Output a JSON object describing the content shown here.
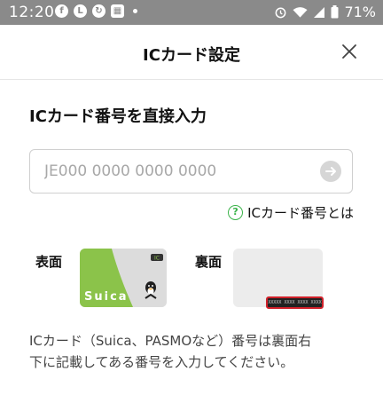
{
  "status_bar": {
    "time": "12:20",
    "battery": "71%",
    "left_icons": [
      "facebook-icon",
      "line-icon",
      "sync-icon",
      "qr-icon"
    ],
    "right_icons": [
      "alarm-icon",
      "wifi-icon",
      "signal-icon",
      "battery-icon"
    ]
  },
  "header": {
    "title": "ICカード設定",
    "close_icon": "close-icon"
  },
  "form": {
    "section_title": "ICカード番号を直接入力",
    "input_value": "",
    "input_placeholder": "JE000 0000 0000 0000",
    "submit_icon": "arrow-right-icon"
  },
  "help": {
    "icon": "question-icon",
    "label": "ICカード番号とは"
  },
  "cards": {
    "front_label": "表面",
    "back_label": "裏面",
    "front_brand": "Suica",
    "back_number": "XXXXX XXXX XXXX XXXX"
  },
  "description": {
    "line1": "ICカード（Suica、PASMOなど）番号は裏面右",
    "line2": "下に記載してある番号を入力してください。"
  },
  "colors": {
    "accent_green": "#3bb34a",
    "suica_green": "#8bc34a",
    "highlight_red": "#d0202a",
    "status_bar": "#8a8a8a"
  }
}
